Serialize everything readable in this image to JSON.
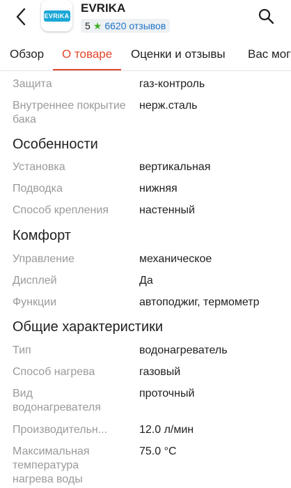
{
  "header": {
    "brand": "EVRIKA",
    "logo_text": "EVRiKA",
    "rating": "5",
    "reviews": "6620 отзывов",
    "accent_color": "#e3452b",
    "link_color": "#1e73c9",
    "star_color": "#43b02a"
  },
  "tabs": [
    {
      "label": "Обзор"
    },
    {
      "label": "О товаре"
    },
    {
      "label": "Оценки и отзывы"
    },
    {
      "label": "Вас могут заинтересовать"
    }
  ],
  "top_rows": [
    {
      "label": "Защита",
      "value": "газ-контроль"
    },
    {
      "label": "Внутреннее покрытие бака",
      "value": "нерж.сталь"
    }
  ],
  "sections": [
    {
      "title": "Особенности",
      "rows": [
        {
          "label": "Установка",
          "value": "вертикальная"
        },
        {
          "label": "Подводка",
          "value": "нижняя"
        },
        {
          "label": "Способ крепления",
          "value": "настенный"
        }
      ]
    },
    {
      "title": "Комфорт",
      "rows": [
        {
          "label": "Управление",
          "value": "механическое"
        },
        {
          "label": "Дисплей",
          "value": "Да"
        },
        {
          "label": "Функции",
          "value": "автоподжиг, термометр"
        }
      ]
    },
    {
      "title": "Общие характеристики",
      "rows": [
        {
          "label": "Тип",
          "value": "водонагреватель"
        },
        {
          "label": "Способ нагрева",
          "value": "газовый"
        },
        {
          "label": "Вид водонагревателя",
          "value": "проточный"
        },
        {
          "label": "Производительн...",
          "value": "12.0 л/мин"
        },
        {
          "label": "Максимальная температура нагрева воды",
          "value": "75.0 °C"
        }
      ]
    }
  ]
}
